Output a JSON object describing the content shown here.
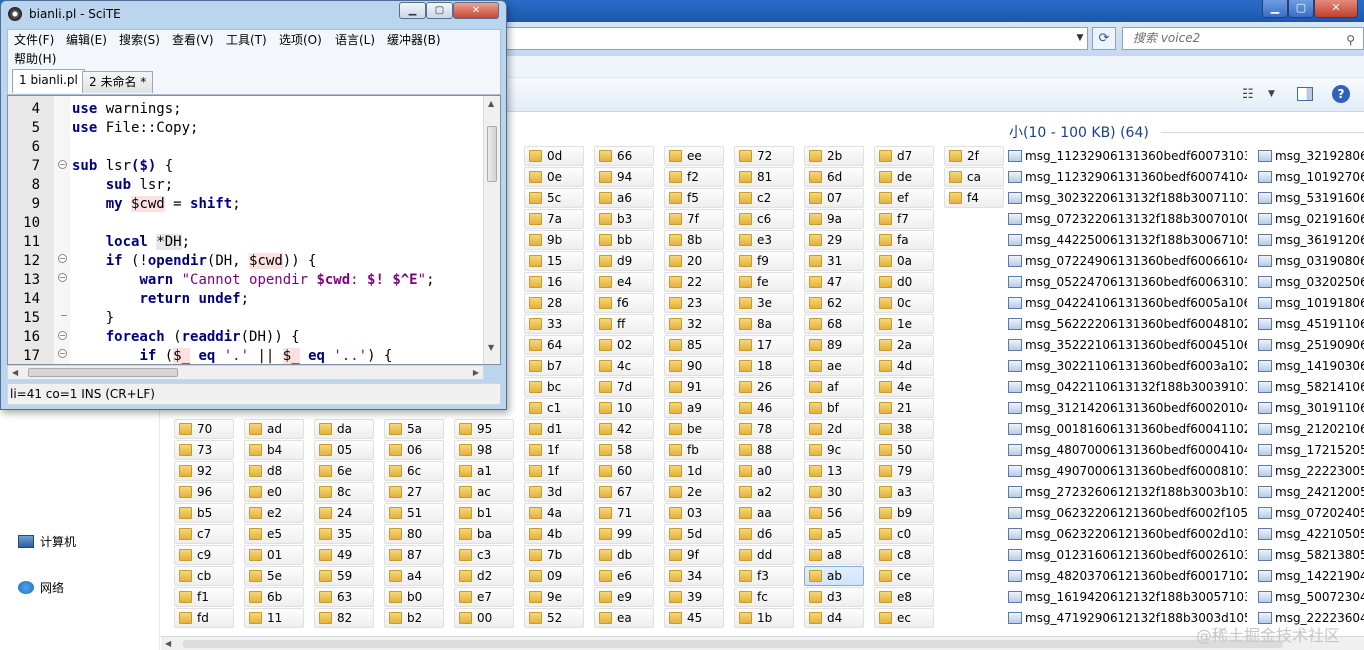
{
  "explorer": {
    "search_placeholder": "搜索 voice2",
    "group_header": "小(10 - 100 KB) (64)",
    "nav": {
      "computer": "计算机",
      "network": "网络"
    },
    "folders": [
      [
        "",
        "",
        "",
        "",
        "",
        "0d",
        "66",
        "ee",
        "72",
        "2b",
        "d7",
        "2f"
      ],
      [
        "",
        "",
        "",
        "",
        "",
        "0e",
        "94",
        "f2",
        "81",
        "6d",
        "de",
        "ca"
      ],
      [
        "",
        "",
        "",
        "",
        "",
        "5c",
        "a6",
        "f5",
        "c2",
        "07",
        "ef",
        "f4"
      ],
      [
        "",
        "",
        "",
        "",
        "",
        "7a",
        "b3",
        "7f",
        "c6",
        "9a",
        "f7",
        ""
      ],
      [
        "",
        "",
        "",
        "",
        "",
        "9b",
        "bb",
        "8b",
        "e3",
        "29",
        "fa",
        ""
      ],
      [
        "",
        "",
        "",
        "",
        "",
        "15",
        "d9",
        "20",
        "f9",
        "31",
        "0a",
        ""
      ],
      [
        "",
        "",
        "",
        "",
        "",
        "16",
        "e4",
        "22",
        "fe",
        "47",
        "d0",
        ""
      ],
      [
        "",
        "",
        "",
        "",
        "",
        "28",
        "f6",
        "23",
        "3e",
        "62",
        "0c",
        ""
      ],
      [
        "",
        "",
        "",
        "",
        "",
        "33",
        "ff",
        "32",
        "8a",
        "68",
        "1e",
        ""
      ],
      [
        "",
        "",
        "",
        "",
        "",
        "64",
        "02",
        "85",
        "17",
        "89",
        "2a",
        ""
      ],
      [
        "",
        "",
        "",
        "",
        "",
        "b7",
        "4c",
        "90",
        "18",
        "ae",
        "4d",
        ""
      ],
      [
        "",
        "",
        "",
        "",
        "",
        "bc",
        "7d",
        "91",
        "26",
        "af",
        "4e",
        ""
      ],
      [
        "",
        "",
        "",
        "",
        "",
        "c1",
        "10",
        "a9",
        "46",
        "bf",
        "21",
        ""
      ],
      [
        "70",
        "ad",
        "da",
        "5a",
        "95",
        "d1",
        "42",
        "be",
        "78",
        "2d",
        "38",
        ""
      ],
      [
        "73",
        "b4",
        "05",
        "06",
        "98",
        "1f",
        "58",
        "fb",
        "88",
        "9c",
        "50",
        ""
      ],
      [
        "92",
        "d8",
        "6e",
        "6c",
        "a1",
        "1f",
        "60",
        "1d",
        "a0",
        "13",
        "79",
        ""
      ],
      [
        "96",
        "e0",
        "8c",
        "27",
        "ac",
        "3d",
        "67",
        "2e",
        "a2",
        "30",
        "a3",
        ""
      ],
      [
        "b5",
        "e2",
        "24",
        "51",
        "b1",
        "4a",
        "71",
        "03",
        "aa",
        "56",
        "b9",
        ""
      ],
      [
        "c7",
        "e5",
        "35",
        "80",
        "ba",
        "4b",
        "99",
        "5d",
        "d6",
        "a5",
        "c0",
        ""
      ],
      [
        "c9",
        "01",
        "49",
        "87",
        "c3",
        "7b",
        "db",
        "9f",
        "dd",
        "a8",
        "c8",
        ""
      ],
      [
        "cb",
        "5e",
        "59",
        "a4",
        "d2",
        "09",
        "e6",
        "34",
        "f3",
        "ab",
        "ce",
        ""
      ],
      [
        "f1",
        "6b",
        "63",
        "b0",
        "e7",
        "9e",
        "e9",
        "39",
        "fc",
        "d3",
        "e8",
        ""
      ],
      [
        "fd",
        "11",
        "82",
        "b2",
        "00",
        "52",
        "ea",
        "45",
        "1b",
        "d4",
        "ec",
        ""
      ]
    ],
    "selected_folder": "ab",
    "files_col1": [
      "msg_11232906131360bedf60073103",
      "msg_11232906131360bedf60074104",
      "msg_3023220613132f188b30071101",
      "msg_0723220613132f188b30070100",
      "msg_4422500613132f188b30067105",
      "msg_07224906131360bedf60066104",
      "msg_05224706131360bedf60063101",
      "msg_04224106131360bedf6005a106",
      "msg_56222206131360bedf60048102",
      "msg_35222106131360bedf60045106",
      "msg_30221106131360bedf6003a102",
      "msg_0422110613132f188b30039101",
      "msg_31214206131360bedf60020104",
      "msg_00181606131360bedf60041102",
      "msg_48070006131360bedf60004104",
      "msg_49070006131360bedf60008101",
      "msg_2723260612132f188b3003b103",
      "msg_06232206121360bedf6002f105",
      "msg_06232206121360bedf6002d103",
      "msg_01231606121360bedf60026103",
      "msg_48203706121360bedf60017102",
      "msg_1619420612132f188b30057103",
      "msg_4719290612132f188b3003d105"
    ],
    "files_col2": [
      "msg_32192806",
      "msg_10192706",
      "msg_53191606",
      "msg_02191606",
      "msg_36191206",
      "msg_03190806",
      "msg_03202506",
      "msg_10191806",
      "msg_45191106",
      "msg_25190906",
      "msg_14190306",
      "msg_58214106",
      "msg_30191106",
      "msg_21202106",
      "msg_17215205",
      "msg_22223005",
      "msg_24212005",
      "msg_07202405",
      "msg_42210505",
      "msg_58213805",
      "msg_14221904",
      "msg_50072304",
      "msg_22223604"
    ]
  },
  "scite": {
    "title": "bianli.pl - SciTE",
    "menu": [
      "文件(F)",
      "编辑(E)",
      "搜索(S)",
      "查看(V)",
      "工具(T)",
      "选项(O)",
      "语言(L)",
      "缓冲器(B)",
      "帮助(H)"
    ],
    "tabs": [
      "1 bianli.pl",
      "2 未命名 *"
    ],
    "line_numbers": [
      "4",
      "5",
      "6",
      "7",
      "8",
      "9",
      "10",
      "11",
      "12",
      "13",
      "14",
      "15",
      "16",
      "17"
    ],
    "status": "li=41 co=1 INS (CR+LF)"
  },
  "watermark": "@稀土掘金技术社区",
  "colors": {
    "keyword": "#00007f",
    "string": "#7f007f",
    "variable_bg": "#ffe0e0",
    "title_bar": "#bcd5ef"
  }
}
